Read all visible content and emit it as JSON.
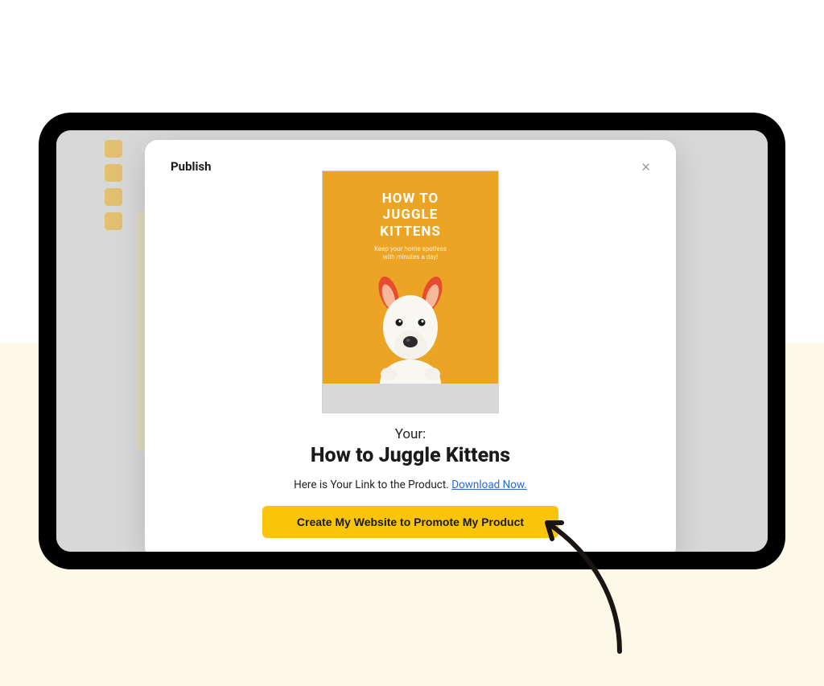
{
  "modal": {
    "title": "Publish",
    "close_symbol": "×",
    "preview": {
      "cover_title": "HOW TO\nJUGGLE\nKITTENS",
      "cover_subtitle": "Keep your home spotless\nwith minutes a day!"
    },
    "your_label": "Your:",
    "product_name": "How to Juggle Kittens",
    "link_text": "Here is Your Link to the Product.  ",
    "download_link_text": "Download Now.",
    "cta_label": "Create My Website to Promote My Product"
  },
  "colors": {
    "accent": "#fac409",
    "cover": "#eba423",
    "link": "#2a6bd4"
  }
}
